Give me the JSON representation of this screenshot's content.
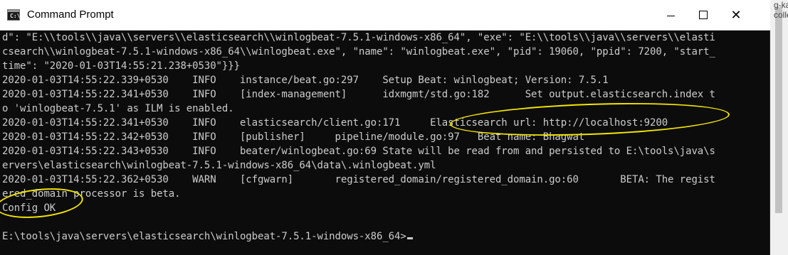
{
  "window": {
    "title": "Command Prompt",
    "icon_text": "C:\\",
    "controls": {
      "minimize": "minimize-icon",
      "maximize": "maximize-icon",
      "close": "close-icon",
      "close_glyph": "✕"
    }
  },
  "console": {
    "lines": [
      "d\": \"E:\\\\tools\\\\java\\\\servers\\\\elasticsearch\\\\winlogbeat-7.5.1-windows-x86_64\", \"exe\": \"E:\\\\tools\\\\java\\\\servers\\\\elasti",
      "csearch\\\\winlogbeat-7.5.1-windows-x86_64\\\\winlogbeat.exe\", \"name\": \"winlogbeat.exe\", \"pid\": 19060, \"ppid\": 7200, \"start_",
      "time\": \"2020-01-03T14:55:21.238+0530\"}}}",
      "2020-01-03T14:55:22.339+0530    INFO    instance/beat.go:297    Setup Beat: winlogbeat; Version: 7.5.1",
      "2020-01-03T14:55:22.341+0530    INFO    [index-management]      idxmgmt/std.go:182      Set output.elasticsearch.index t",
      "o 'winlogbeat-7.5.1' as ILM is enabled.",
      "2020-01-03T14:55:22.341+0530    INFO    elasticsearch/client.go:171     Elasticsearch url: http://localhost:9200",
      "2020-01-03T14:55:22.342+0530    INFO    [publisher]     pipeline/module.go:97   Beat name: Bhagwat",
      "2020-01-03T14:55:22.343+0530    INFO    beater/winlogbeat.go:69 State will be read from and persisted to E:\\tools\\java\\s",
      "ervers\\elasticsearch\\winlogbeat-7.5.1-windows-x86_64\\data\\.winlogbeat.yml",
      "2020-01-03T14:55:22.362+0530    WARN    [cfgwarn]       registered_domain/registered_domain.go:60       BETA: The regist",
      "ered_domain processor is beta.",
      "Config OK",
      "",
      "E:\\tools\\java\\servers\\elasticsearch\\winlogbeat-7.5.1-windows-x86_64>"
    ]
  },
  "background_fragments": {
    "top_right": "g-ka collection"
  },
  "colors": {
    "console_bg": "#0c0c0c",
    "console_text": "#cccccc",
    "annotation": "#f3e600"
  }
}
